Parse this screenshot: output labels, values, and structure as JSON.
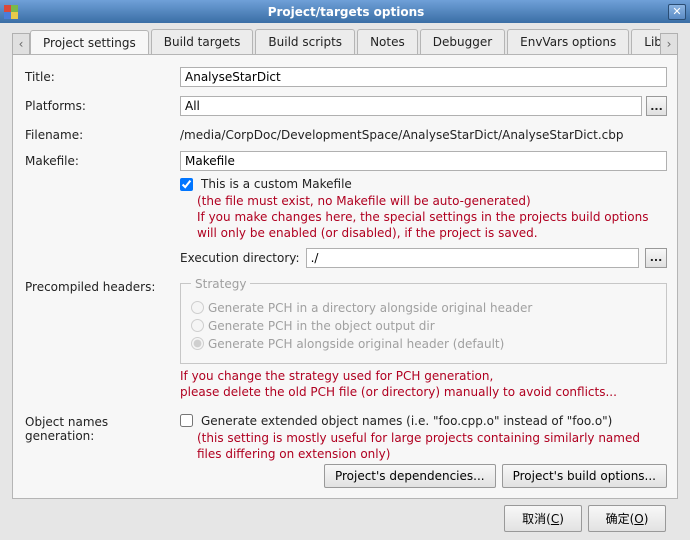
{
  "window": {
    "title": "Project/targets options",
    "close_glyph": "✕"
  },
  "tabs": {
    "scroll_left": "‹",
    "scroll_right": "›",
    "items": [
      {
        "label": "Project settings",
        "active": true
      },
      {
        "label": "Build targets",
        "active": false
      },
      {
        "label": "Build scripts",
        "active": false
      },
      {
        "label": "Notes",
        "active": false
      },
      {
        "label": "Debugger",
        "active": false
      },
      {
        "label": "EnvVars options",
        "active": false
      },
      {
        "label": "Libraries",
        "active": false
      }
    ]
  },
  "form": {
    "title_label": "Title:",
    "title_value": "AnalyseStarDict",
    "platforms_label": "Platforms:",
    "platforms_value": "All",
    "browse_glyph": "...",
    "filename_label": "Filename:",
    "filename_value": "/media/CorpDoc/DevelopmentSpace/AnalyseStarDict/AnalyseStarDict.cbp",
    "makefile_label": "Makefile:",
    "makefile_value": "Makefile",
    "custom_makefile_checked": true,
    "custom_makefile_label": "This is a custom Makefile",
    "custom_makefile_hint": "(the file must exist, no Makefile will be auto-generated)\nIf you make changes here, the special settings in the projects build options will only be enabled (or disabled), if the project is saved.",
    "exec_dir_label": "Execution directory:",
    "exec_dir_value": "./",
    "pch_label": "Precompiled headers:",
    "pch": {
      "legend": "Strategy",
      "options": [
        {
          "label": "Generate PCH in a directory alongside original header",
          "checked": false
        },
        {
          "label": "Generate PCH in the object output dir",
          "checked": false
        },
        {
          "label": "Generate PCH alongside original header (default)",
          "checked": true
        }
      ],
      "hint": "If you change the strategy used for PCH generation,\nplease delete the old PCH file (or directory) manually to avoid conflicts..."
    },
    "obj_label": "Object names generation:",
    "obj_checked": false,
    "obj_checkbox_label": "Generate extended object names (i.e. \"foo.cpp.o\" instead of \"foo.o\")",
    "obj_hint": "(this setting is mostly useful for large projects containing similarly named files differing on extension only)",
    "dependencies_btn": "Project's dependencies...",
    "build_options_btn": "Project's build options..."
  },
  "dialog_buttons": {
    "cancel": "取消",
    "cancel_key": "C",
    "ok": "确定",
    "ok_key": "O"
  }
}
